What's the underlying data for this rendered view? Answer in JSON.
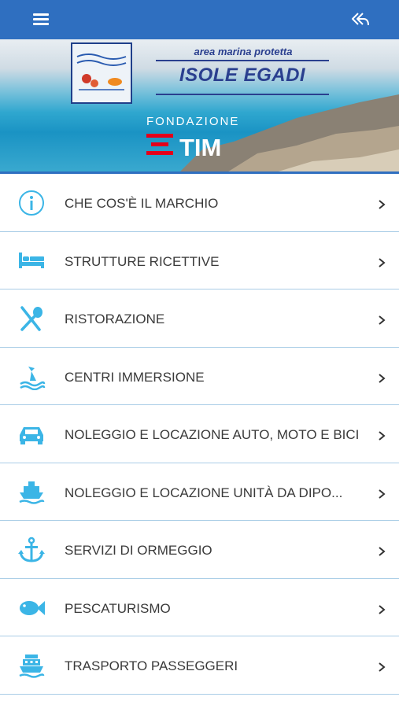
{
  "header": {
    "menu_icon": "hamburger-menu-icon",
    "back_icon": "reply-back-icon",
    "bg_color": "#2f6fc0"
  },
  "banner": {
    "amp_tagline": "area marina protetta",
    "amp_name": "ISOLE EGADI",
    "foundation": "FONDAZIONE",
    "sponsor": "TIM"
  },
  "menu": {
    "accent_color": "#3bb5e6",
    "items": [
      {
        "label": "CHE COS'È IL MARCHIO",
        "icon": "info-icon"
      },
      {
        "label": "STRUTTURE RICETTIVE",
        "icon": "bed-icon"
      },
      {
        "label": "RISTORAZIONE",
        "icon": "fork-spoon-icon"
      },
      {
        "label": "CENTRI IMMERSIONE",
        "icon": "diver-icon"
      },
      {
        "label": "NOLEGGIO E LOCAZIONE AUTO, MOTO E BICI",
        "icon": "car-icon"
      },
      {
        "label": "NOLEGGIO E LOCAZIONE UNITÀ DA DIPO...",
        "icon": "ship-icon"
      },
      {
        "label": "SERVIZI DI ORMEGGIO",
        "icon": "anchor-icon"
      },
      {
        "label": "PESCATURISMO",
        "icon": "fish-icon"
      },
      {
        "label": "TRASPORTO PASSEGGERI",
        "icon": "ferry-icon"
      }
    ]
  }
}
